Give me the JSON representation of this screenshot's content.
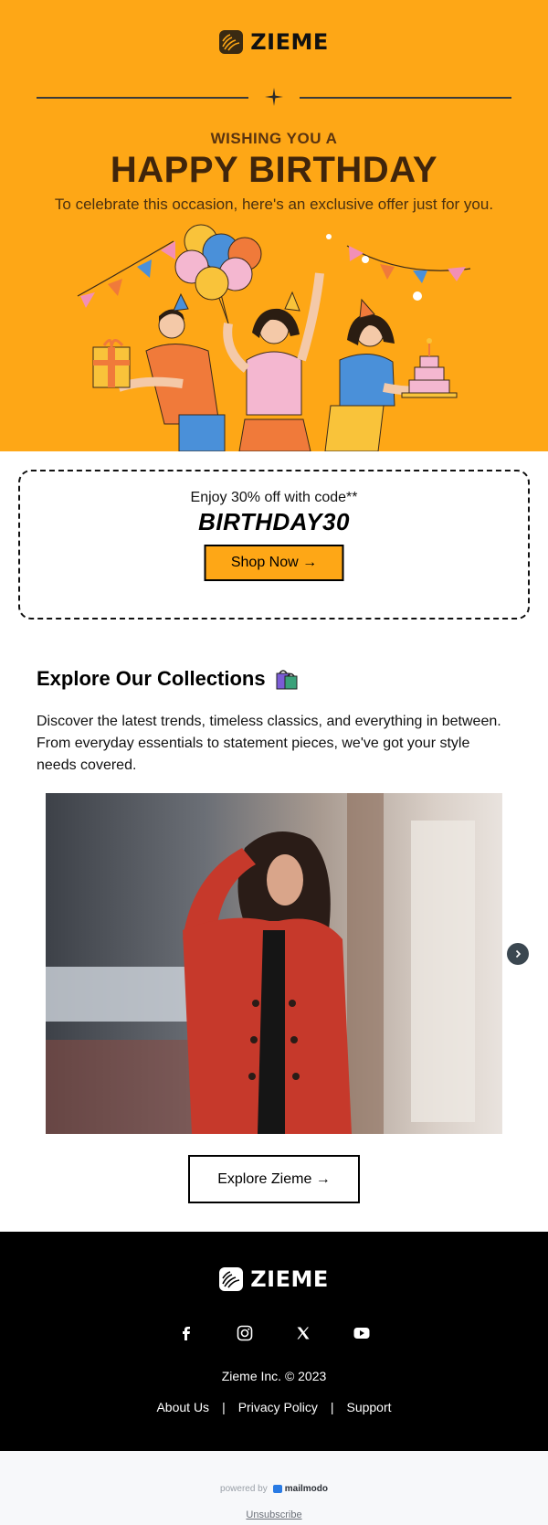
{
  "brand": {
    "name": "ZIEME"
  },
  "hero": {
    "eyebrow": "WISHING YOU A",
    "headline": "HAPPY BIRTHDAY",
    "subline": "To celebrate this occasion, here's an exclusive offer just for you."
  },
  "coupon": {
    "enjoy_text": "Enjoy 30% off with code**",
    "code": "BIRTHDAY30",
    "shop_label": "Shop Now →"
  },
  "collections": {
    "title": "Explore Our Collections",
    "description": "Discover the latest trends, timeless classics, and everything in between. From everyday essentials to statement pieces, we've got your style needs covered.",
    "explore_label": "Explore Zieme →"
  },
  "footer": {
    "socials": [
      "facebook-icon",
      "instagram-icon",
      "x-icon",
      "youtube-icon"
    ],
    "copyright": "Zieme Inc. © 2023",
    "links": [
      {
        "label": "About Us"
      },
      {
        "label": "Privacy Policy"
      },
      {
        "label": "Support"
      }
    ],
    "separator": "|"
  },
  "bottom": {
    "powered_by": "powered by",
    "provider": "mailmodo",
    "unsubscribe": "Unsubscribe"
  },
  "colors": {
    "accent": "#FEA716",
    "hero_text": "#40250b",
    "footer_bg": "#000000",
    "bottom_bg": "#F7F8FA"
  }
}
